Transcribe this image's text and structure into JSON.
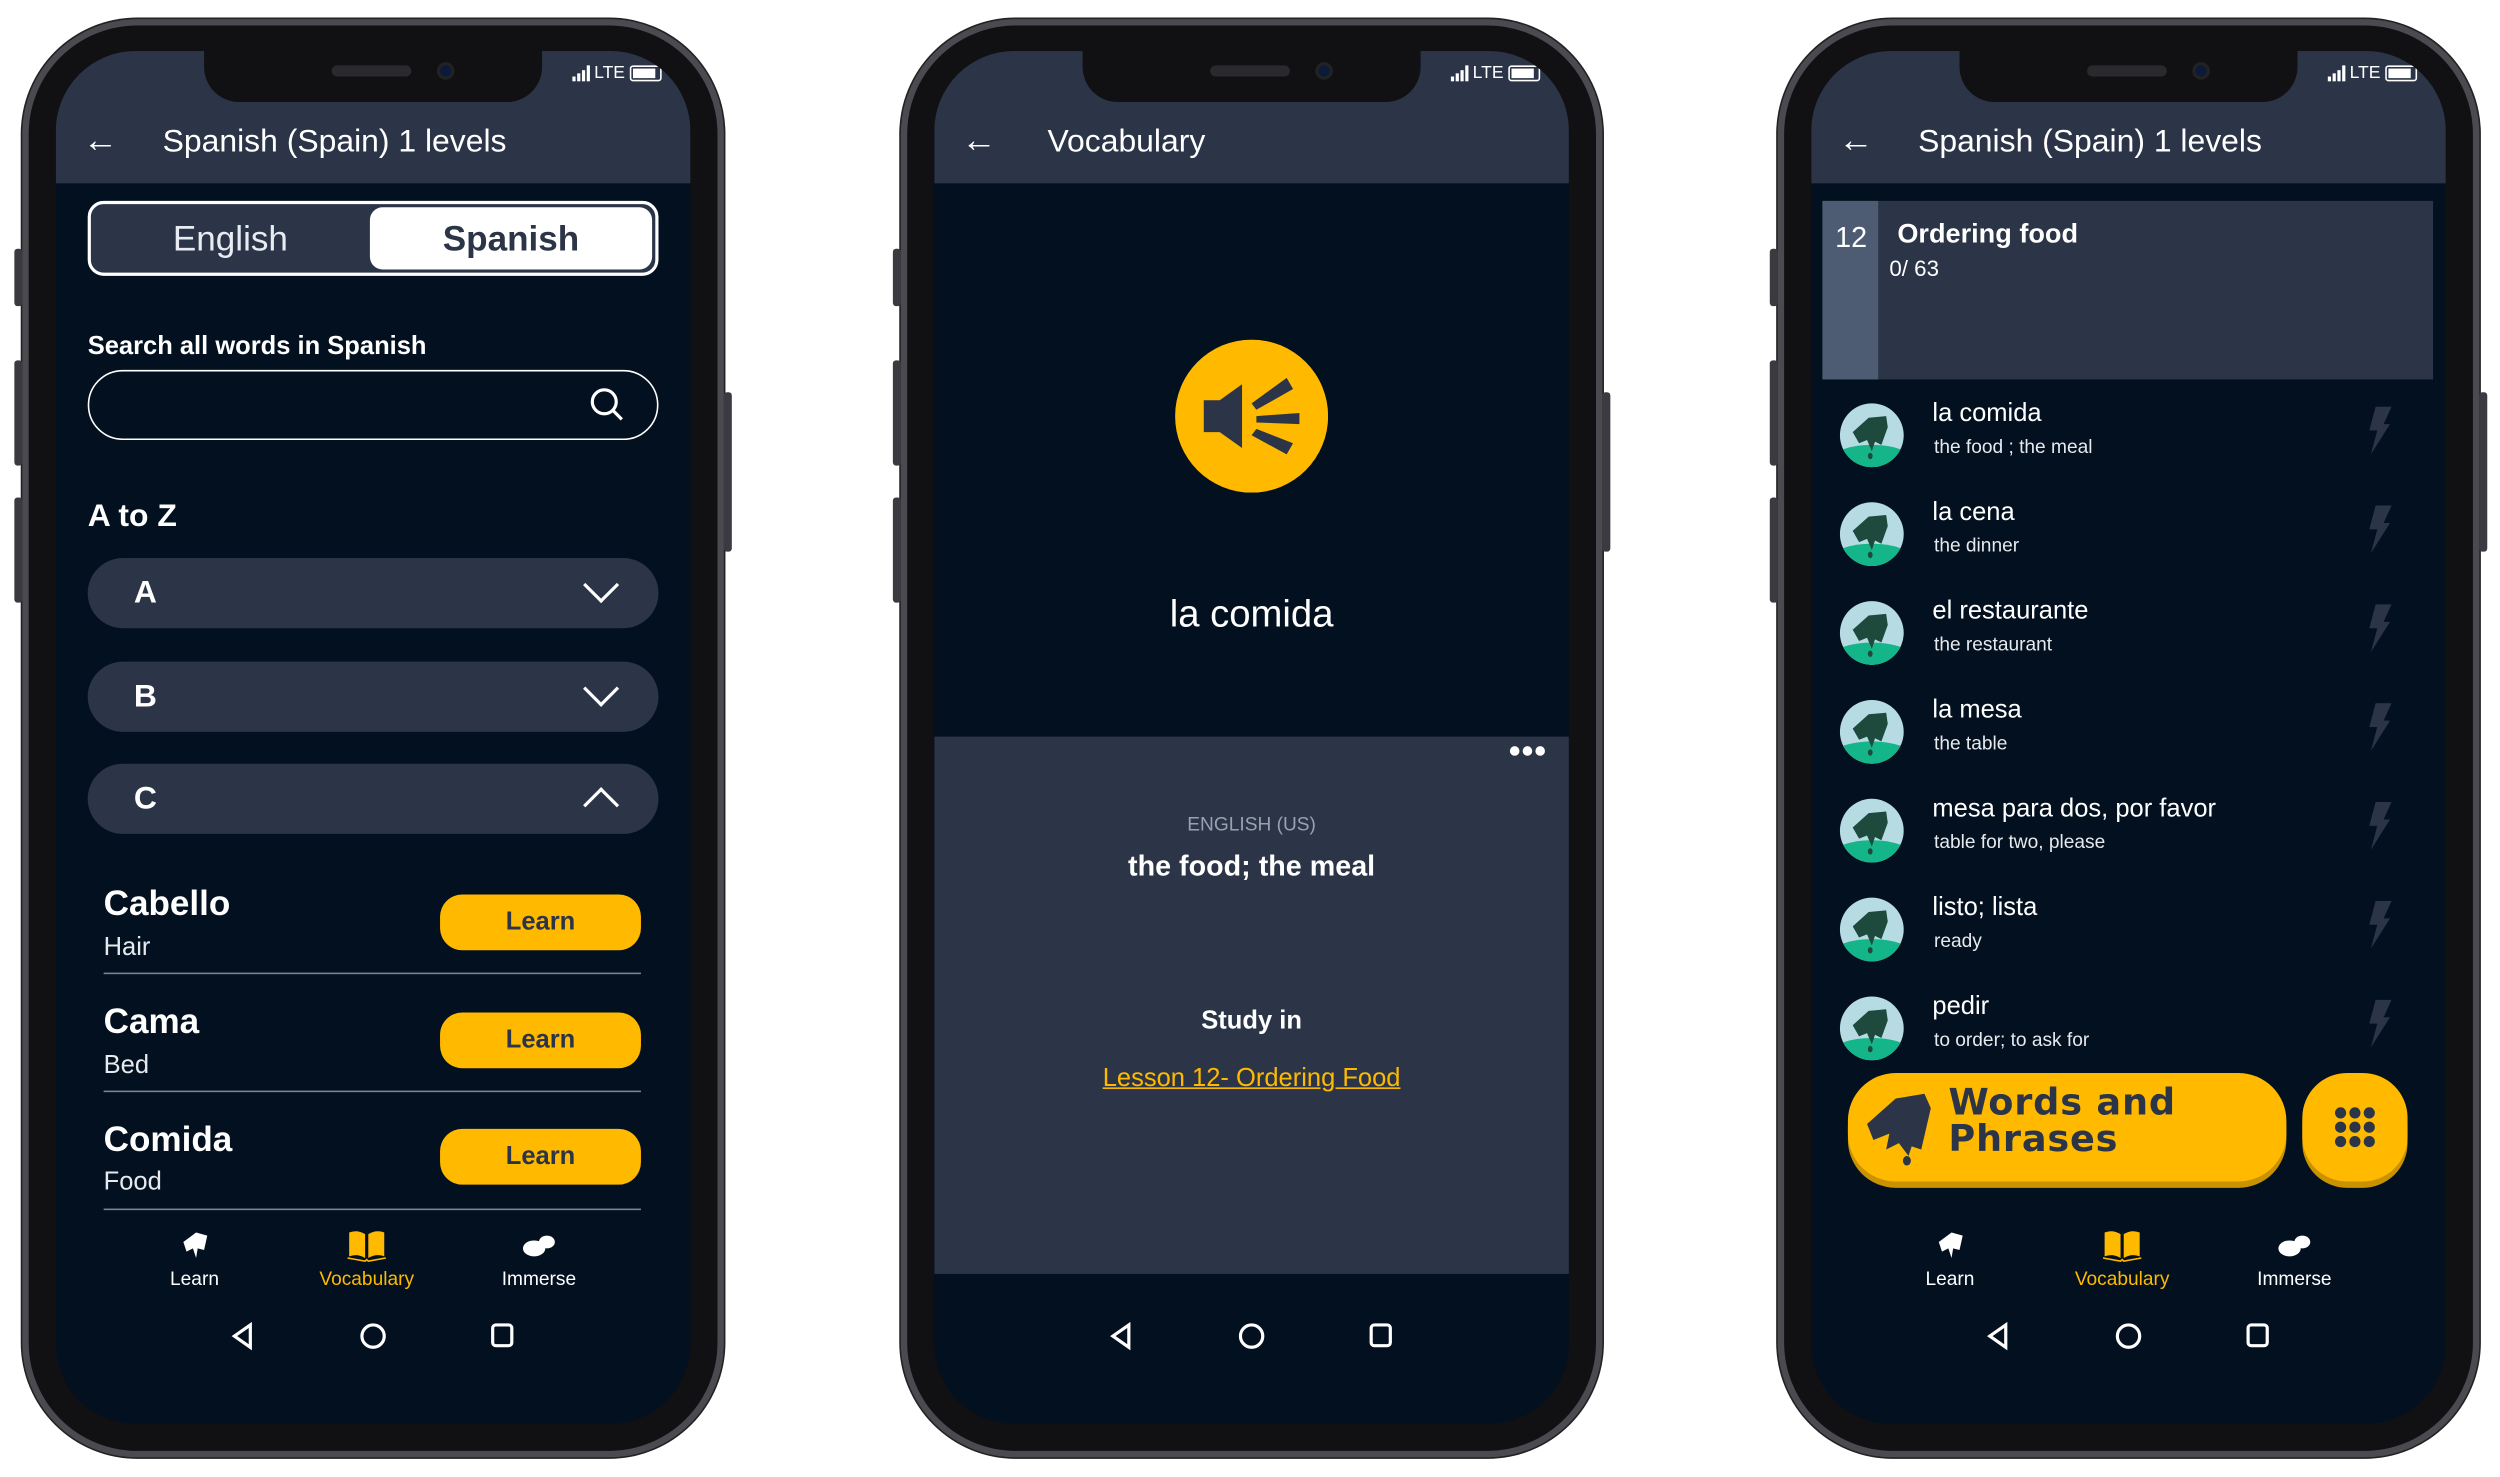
{
  "status": {
    "network": "LTE"
  },
  "colors": {
    "accent": "#ffba00",
    "background": "#02101f",
    "header": "#2b3547",
    "avatar_green": "#15b58a"
  },
  "screen1": {
    "title": "Spanish (Spain) 1 levels",
    "toggle": {
      "left": "English",
      "right": "Spanish",
      "selected": "Spanish"
    },
    "search_label": "Search all words in Spanish",
    "search_placeholder": "",
    "section_title": "A to Z",
    "accordions": [
      {
        "letter": "A",
        "expanded": false
      },
      {
        "letter": "B",
        "expanded": false
      },
      {
        "letter": "C",
        "expanded": true
      }
    ],
    "words": [
      {
        "word": "Cabello",
        "translation": "Hair",
        "button": "Learn"
      },
      {
        "word": "Cama",
        "translation": "Bed",
        "button": "Learn"
      },
      {
        "word": "Comida",
        "translation": "Food",
        "button": "Learn"
      }
    ]
  },
  "bottom_nav": {
    "items": [
      {
        "label": "Learn",
        "icon": "hand-icon"
      },
      {
        "label": "Vocabulary",
        "icon": "book-icon",
        "active": true
      },
      {
        "label": "Immerse",
        "icon": "bubble-icon"
      }
    ]
  },
  "screen2": {
    "title": "Vocabulary",
    "word": "la comida",
    "language_label": "ENGLISH (US)",
    "translation": "the food; the meal",
    "study_in": "Study in",
    "lesson_link": "Lesson 12- Ordering Food"
  },
  "screen3": {
    "title": "Spanish (Spain) 1 levels",
    "lesson": {
      "number": "12",
      "name": "Ordering food",
      "progress": "0/ 63"
    },
    "items": [
      {
        "word": "la comida",
        "translation": "the food ; the meal"
      },
      {
        "word": "la cena",
        "translation": "the dinner"
      },
      {
        "word": "el restaurante",
        "translation": "the restaurant"
      },
      {
        "word": "la mesa",
        "translation": "the table"
      },
      {
        "word": "mesa para dos, por favor",
        "translation": "table for two, please"
      },
      {
        "word": "listo; lista",
        "translation": "ready"
      },
      {
        "word": "pedir",
        "translation": "to order; to ask for"
      }
    ],
    "words_button_line1": "Words and",
    "words_button_line2": "Phrases"
  }
}
